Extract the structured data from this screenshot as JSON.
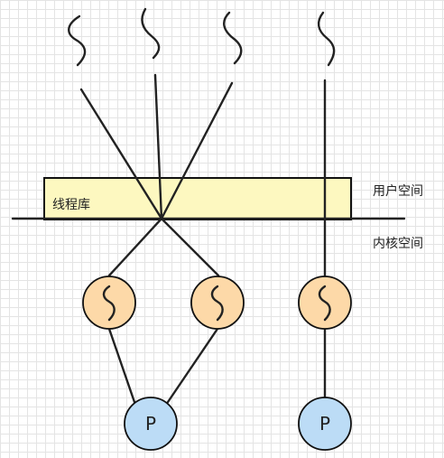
{
  "labels": {
    "thread_library": "线程库",
    "user_space": "用户空间",
    "kernel_space": "内核空间",
    "process_1": "P",
    "process_2": "P"
  },
  "colors": {
    "grid": "#e4e4e4",
    "thread_library_fill": "#fdf8c0",
    "kernel_thread_fill": "#fdd9a8",
    "process_fill": "#bcdcf6",
    "stroke": "#222222"
  },
  "icons": {
    "user_thread": "squiggle-icon",
    "kernel_thread": "squiggle-icon"
  }
}
